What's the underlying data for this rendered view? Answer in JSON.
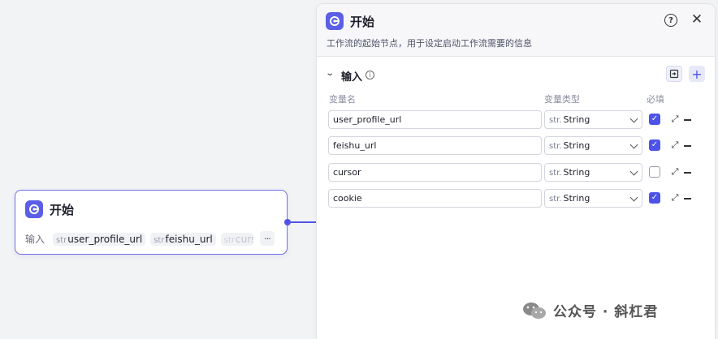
{
  "node": {
    "title": "开始",
    "inputs_label": "输入",
    "chips": [
      {
        "type": "str",
        "name": "user_profile_url"
      },
      {
        "type": "str",
        "name": "feishu_url"
      },
      {
        "type": "str",
        "name": "curs"
      }
    ],
    "more": "···"
  },
  "panel": {
    "title": "开始",
    "description": "工作流的起始节点，用于设定启动工作流需要的信息",
    "section_title": "输入",
    "columns": {
      "name": "变量名",
      "type": "变量类型",
      "required": "必填"
    },
    "rows": [
      {
        "name": "user_profile_url",
        "type_prefix": "str.",
        "type": "String",
        "required": true
      },
      {
        "name": "feishu_url",
        "type_prefix": "str.",
        "type": "String",
        "required": true
      },
      {
        "name": "cursor",
        "type_prefix": "str.",
        "type": "String",
        "required": false
      },
      {
        "name": "cookie",
        "type_prefix": "str.",
        "type": "String",
        "required": true
      }
    ]
  },
  "watermark": {
    "text": "公众号 · 斜杠君"
  },
  "colors": {
    "accent": "#4d53e8",
    "node_border": "#6f6ee8",
    "canvas": "#f2f3f5"
  }
}
